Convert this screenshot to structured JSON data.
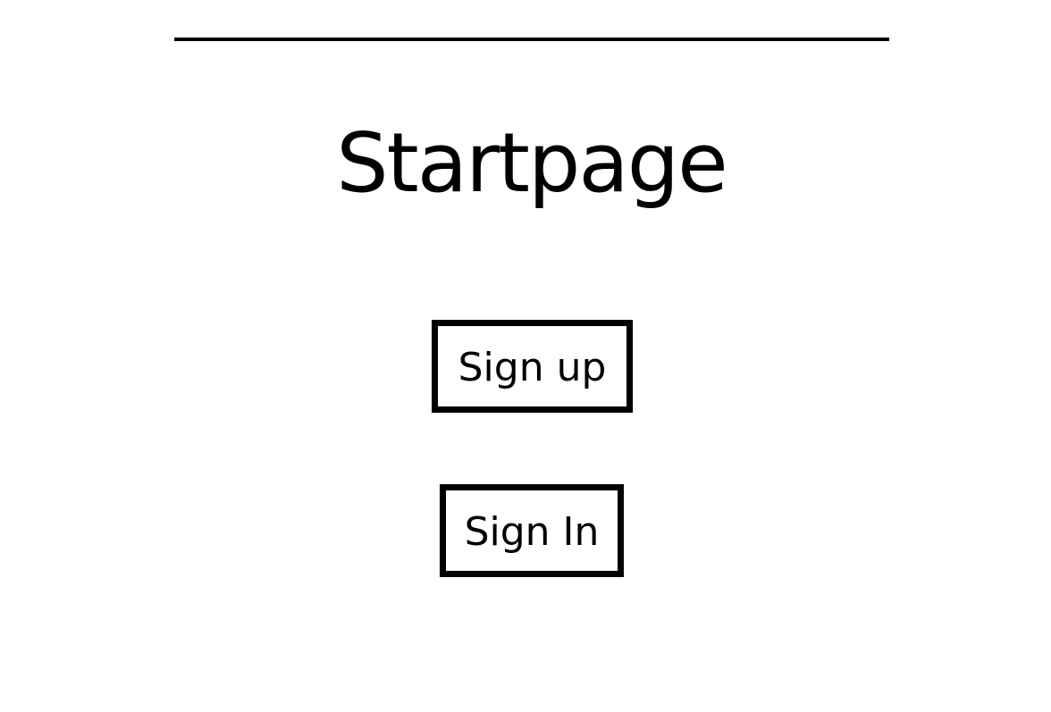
{
  "page": {
    "title": "Startpage"
  },
  "actions": {
    "sign_up_label": "Sign up",
    "sign_in_label": "Sign In"
  },
  "colors": {
    "background": "#ffffff",
    "foreground": "#000000"
  }
}
